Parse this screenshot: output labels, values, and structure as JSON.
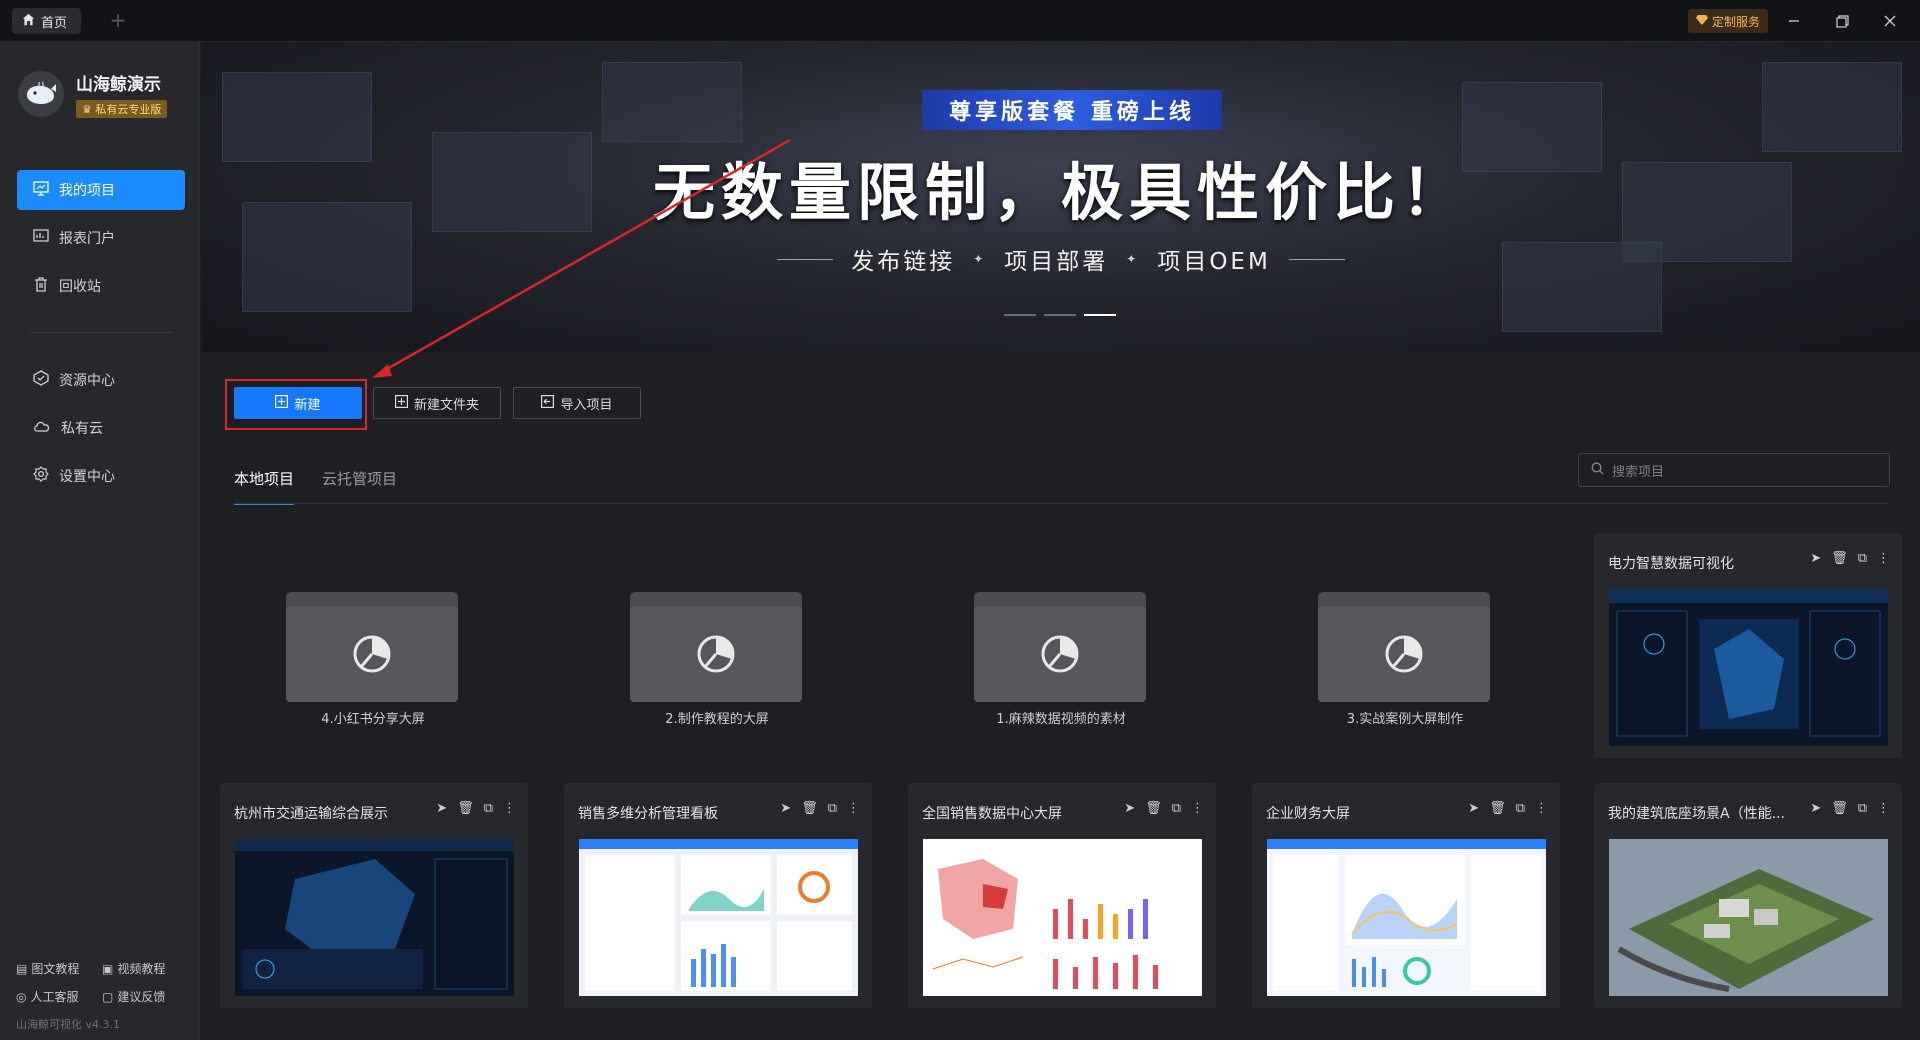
{
  "topbar": {
    "home_tab": "首页",
    "add_tab": "+",
    "custom_service": "定制服务"
  },
  "brand": {
    "name": "山海鲸演示",
    "badge": "私有云专业版"
  },
  "nav": {
    "group1": [
      {
        "label": "我的项目",
        "icon": "monitor-icon",
        "active": true
      },
      {
        "label": "报表门户",
        "icon": "chart-report-icon",
        "active": false
      },
      {
        "label": "回收站",
        "icon": "trash-icon",
        "active": false
      }
    ],
    "group2": [
      {
        "label": "资源中心",
        "icon": "cube-icon"
      },
      {
        "label": "私有云",
        "icon": "cloud-icon"
      },
      {
        "label": "设置中心",
        "icon": "gear-icon"
      }
    ]
  },
  "footer": {
    "links": [
      "图文教程",
      "视频教程",
      "人工客服",
      "建议反馈"
    ],
    "version": "山海鲸可视化 v4.3.1"
  },
  "banner": {
    "pill": "尊享版套餐 重磅上线",
    "title": "无数量限制，极具性价比！",
    "subs": [
      "发布链接",
      "项目部署",
      "项目OEM"
    ],
    "slide_count": 3,
    "active_slide": 3
  },
  "actions": {
    "new": "新建",
    "new_folder": "新建文件夹",
    "import": "导入项目"
  },
  "tabs": [
    "本地项目",
    "云托管项目"
  ],
  "search": {
    "placeholder": "搜索项目"
  },
  "folders": [
    "4.小红书分享大屏",
    "2.制作教程的大屏",
    "1.麻辣数据视频的素材",
    "3.实战案例大屏制作"
  ],
  "projects": [
    {
      "title": "电力智慧数据可视化",
      "theme": "dark"
    },
    {
      "title": "杭州市交通运输综合展示",
      "theme": "dark"
    },
    {
      "title": "销售多维分析管理看板",
      "theme": "light"
    },
    {
      "title": "全国销售数据中心大屏",
      "theme": "light"
    },
    {
      "title": "企业财务大屏",
      "theme": "light"
    },
    {
      "title": "我的建筑底座场景A（性能...",
      "theme": "3d"
    }
  ],
  "colors": {
    "accent": "#1677ff",
    "highlight_box": "#d62828",
    "badge": "#f3b64c"
  }
}
